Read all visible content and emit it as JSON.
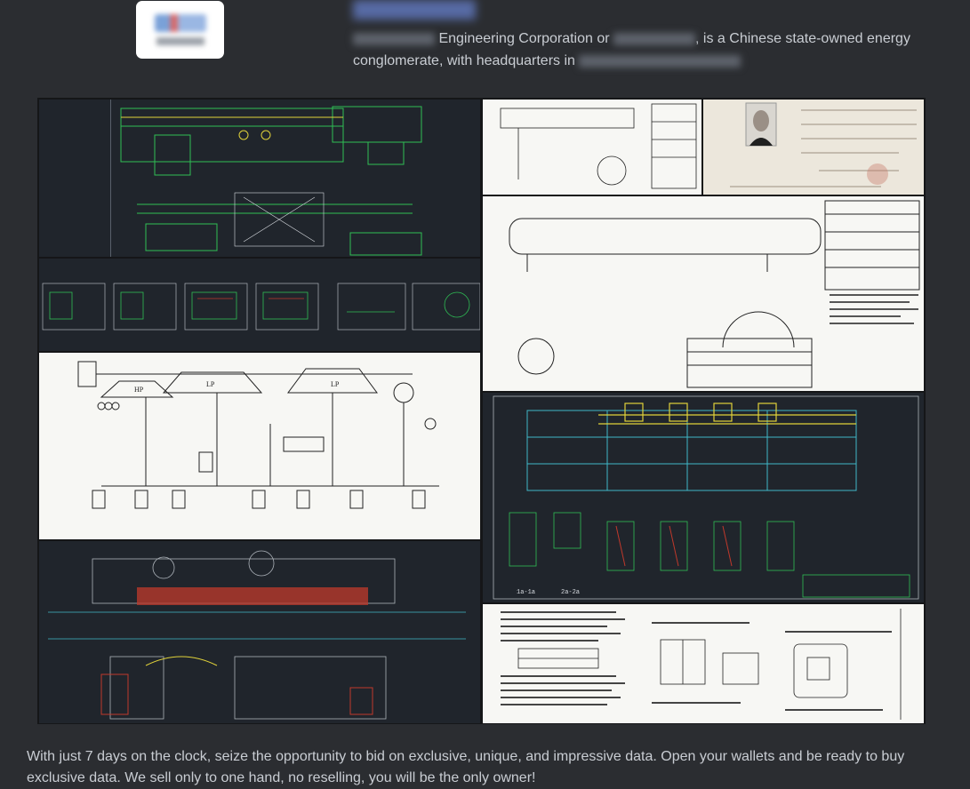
{
  "post": {
    "org_desc_mid": "Engineering Corporation or",
    "org_desc_tail": ", is a Chinese state-owned energy",
    "org_desc_line2": "conglomerate, with headquarters in",
    "body": "With just 7 days on the clock, seize the opportunity to bid on exclusive, unique, and impressive data. Open your wallets and be ready to buy exclusive data. We sell only to one hand, no reselling, you will be the only owner!"
  },
  "images": {
    "tile_pid_labels": {
      "hp": "HP",
      "lp1": "LP",
      "lp2": "LP"
    },
    "tile_drawing_labels": {
      "section_a": "1a-1a",
      "section_b": "2a-2a"
    }
  },
  "colors": {
    "background": "#2b2d31",
    "text": "#c9cdd3",
    "cad_dark": "#20252c",
    "cad_green": "#2fbf55",
    "cad_yellow": "#e0d23a",
    "cad_cyan": "#3fb8c8",
    "cad_red": "#c0392b"
  }
}
